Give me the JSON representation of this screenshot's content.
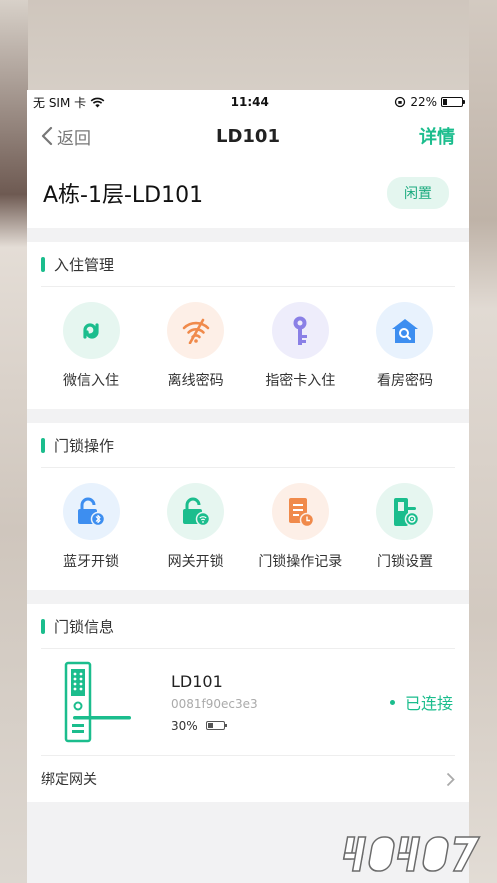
{
  "status_bar": {
    "carrier": "无 SIM 卡",
    "time": "11:44",
    "battery_text": "22%",
    "battery_level": 0.22
  },
  "nav": {
    "back_label": "返回",
    "title": "LD101",
    "action_label": "详情"
  },
  "room": {
    "name": "A栋-1层-LD101",
    "status": "闲置"
  },
  "checkin": {
    "title": "入住管理",
    "items": [
      {
        "label": "微信入住",
        "icon": "wechat-link-icon",
        "bg": "#e6f6f0",
        "color": "#1bbd8d"
      },
      {
        "label": "离线密码",
        "icon": "wifi-off-icon",
        "bg": "#fdefe7",
        "color": "#f08a4b"
      },
      {
        "label": "指密卡入住",
        "icon": "key-icon",
        "bg": "#eeedfb",
        "color": "#8a80e6"
      },
      {
        "label": "看房密码",
        "icon": "house-search-icon",
        "bg": "#e8f2fd",
        "color": "#3d8ef0"
      }
    ]
  },
  "lock_ops": {
    "title": "门锁操作",
    "items": [
      {
        "label": "蓝牙开锁",
        "icon": "bluetooth-unlock-icon",
        "bg": "#e8f2fd",
        "color": "#3d8ef0"
      },
      {
        "label": "网关开锁",
        "icon": "gateway-unlock-icon",
        "bg": "#e6f6f0",
        "color": "#1bbd8d"
      },
      {
        "label": "门锁操作记录",
        "icon": "record-icon",
        "bg": "#fdefe7",
        "color": "#f08a4b"
      },
      {
        "label": "门锁设置",
        "icon": "lock-settings-icon",
        "bg": "#e6f6f0",
        "color": "#1bbd8d"
      }
    ]
  },
  "lock_info": {
    "title": "门锁信息",
    "name": "LD101",
    "mac": "0081f90ec3e3",
    "battery_text": "30%",
    "battery_level": 0.3,
    "connection": "已连接",
    "gateway_label": "绑定网关"
  },
  "colors": {
    "accent": "#1bbd8d"
  }
}
